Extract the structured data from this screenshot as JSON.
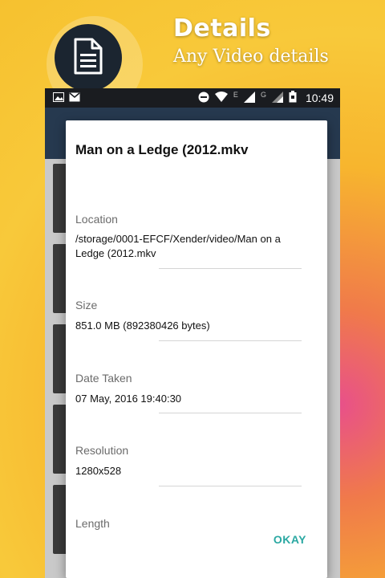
{
  "promo": {
    "title": "Details",
    "subtitle": "Any Video details"
  },
  "status_bar": {
    "time": "10:49",
    "network_label_e": "E",
    "network_label_g": "G"
  },
  "dialog": {
    "title": "Man on a Ledge (2012.mkv",
    "fields": [
      {
        "label": "Location",
        "value": "/storage/0001-EFCF/Xender/video/Man on a Ledge (2012.mkv"
      },
      {
        "label": "Size",
        "value": "851.0 MB (892380426 bytes)"
      },
      {
        "label": "Date Taken",
        "value": "07 May, 2016 19:40:30"
      },
      {
        "label": "Resolution",
        "value": "1280x528"
      },
      {
        "label": "Length",
        "value": ""
      }
    ],
    "ok_label": "OKAY"
  },
  "colors": {
    "accent": "#2aa8a2",
    "app_bar": "#26394f",
    "status_bar": "#1a1c20",
    "promo_circle": "#1b2530"
  },
  "icons": [
    "document-icon",
    "image-icon",
    "mail-icon",
    "do-not-disturb-icon",
    "wifi-icon",
    "signal-icon",
    "battery-icon"
  ]
}
